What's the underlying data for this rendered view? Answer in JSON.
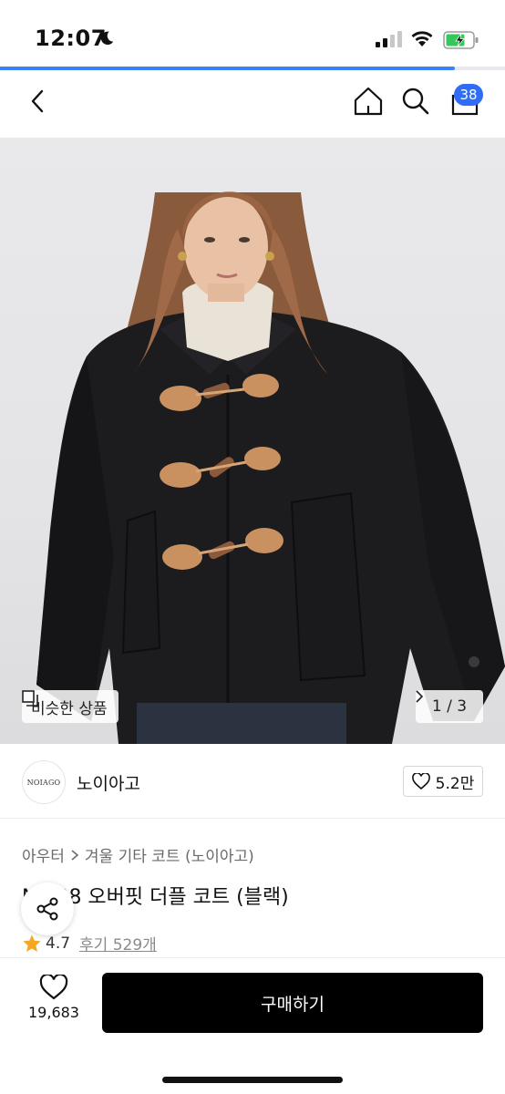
{
  "status_bar": {
    "time": "12:07",
    "page_load_progress": 0.9
  },
  "nav": {
    "cart_count": "38"
  },
  "product_image": {
    "similar_label": "비슷한 상품",
    "page_indicator": "1 / 3"
  },
  "brand": {
    "logo_text": "NOIAGO",
    "name": "노이아고",
    "likes": "5.2만"
  },
  "breadcrumb": {
    "category": "아우터",
    "subcategory": "겨울 기타 코트 (노이아고)"
  },
  "product": {
    "title": "N  498 오버핏 더플 코트 (블랙)",
    "rating": "4.7",
    "review_label": "후기 529개"
  },
  "bottom_bar": {
    "wish_count": "19,683",
    "buy_label": "구매하기"
  },
  "colors": {
    "accent": "#3b82f6",
    "badge": "#2f6df6",
    "star": "#f5a623",
    "buy_button": "#000000"
  }
}
